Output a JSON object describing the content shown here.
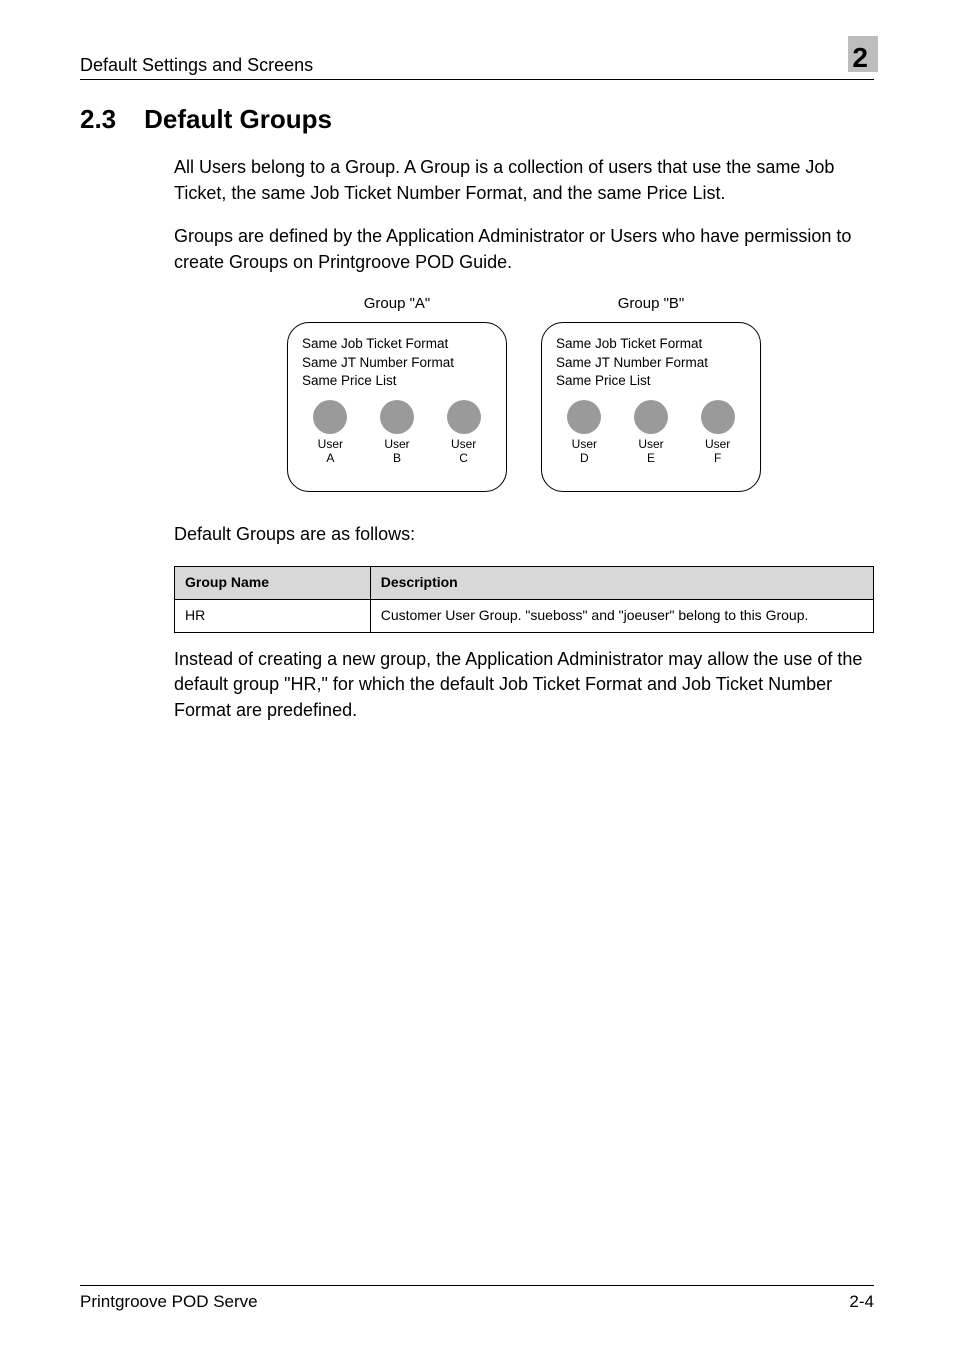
{
  "header": {
    "left": "Default Settings and Screens",
    "chapter": "2"
  },
  "section": {
    "number": "2.3",
    "title": "Default Groups"
  },
  "paragraphs": {
    "p1": "All Users belong to a Group. A Group is a collection of users that use the same Job Ticket, the same Job Ticket Number Format, and the same Price List.",
    "p2": "Groups are defined by the Application Administrator or Users who have permission to create Groups on Printgroove POD Guide.",
    "p3": "Default Groups are as follows:",
    "p4": "Instead of creating a new group, the Application Administrator may allow the use of the default group \"HR,\" for which the default Job Ticket Format and Job Ticket Number Format are predefined."
  },
  "diagram": {
    "groupA": {
      "label": "Group \"A\"",
      "line1": "Same Job Ticket Format",
      "line2": "Same JT Number Format",
      "line3": "Same Price List",
      "users": [
        {
          "l1": "User",
          "l2": "A"
        },
        {
          "l1": "User",
          "l2": "B"
        },
        {
          "l1": "User",
          "l2": "C"
        }
      ]
    },
    "groupB": {
      "label": "Group \"B\"",
      "line1": "Same Job Ticket Format",
      "line2": "Same JT Number Format",
      "line3": "Same Price List",
      "users": [
        {
          "l1": "User",
          "l2": "D"
        },
        {
          "l1": "User",
          "l2": "E"
        },
        {
          "l1": "User",
          "l2": "F"
        }
      ]
    }
  },
  "table": {
    "headers": {
      "col1": "Group Name",
      "col2": "Description"
    },
    "rows": [
      {
        "c1": "HR",
        "c2": "Customer User Group. \"sueboss\" and \"joeuser\" belong to this Group."
      }
    ]
  },
  "footer": {
    "left": "Printgroove POD Serve",
    "right": "2-4"
  }
}
